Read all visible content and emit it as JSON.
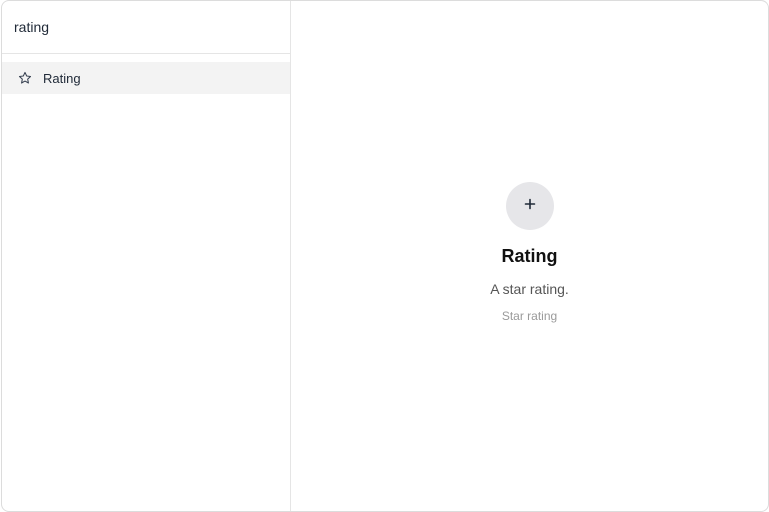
{
  "search": {
    "value": "rating",
    "placeholder": ""
  },
  "results": [
    {
      "label": "Rating",
      "icon": "star-outline-icon"
    }
  ],
  "detail": {
    "action_icon": "plus-icon",
    "title": "Rating",
    "description": "A star rating.",
    "meta": "Star rating"
  },
  "colors": {
    "selected_row": "#f3f3f3",
    "action_circle": "#e6e6e9",
    "muted_text": "#9a9a9a"
  }
}
